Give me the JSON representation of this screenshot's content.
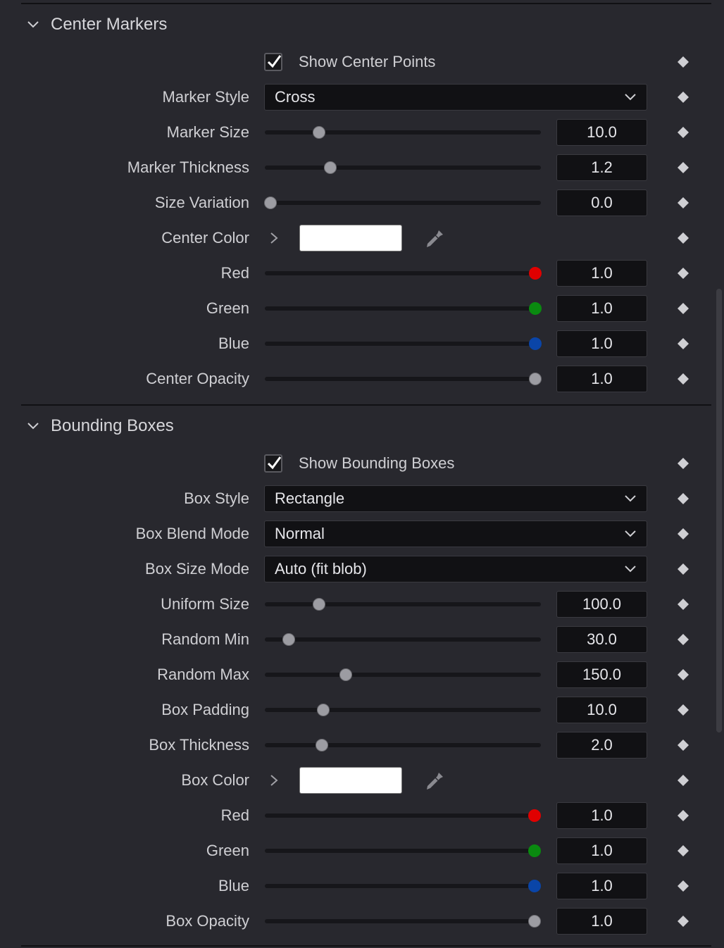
{
  "colors": {
    "red_knob": "#e00000",
    "green_knob": "#0a8a10",
    "blue_knob": "#0a45a8",
    "gray_knob": "#9c9ca2",
    "swatch": "#ffffff"
  },
  "center_markers": {
    "title": "Center Markers",
    "show_center_points": {
      "label": "Show Center Points",
      "checked": true
    },
    "marker_style": {
      "label": "Marker Style",
      "value": "Cross"
    },
    "marker_size": {
      "label": "Marker Size",
      "value": "10.0",
      "fraction": 0.196
    },
    "marker_thickness": {
      "label": "Marker Thickness",
      "value": "1.2",
      "fraction": 0.237
    },
    "size_variation": {
      "label": "Size Variation",
      "value": "0.0",
      "fraction": 0.02
    },
    "center_color": {
      "label": "Center Color",
      "swatch": "#ffffff"
    },
    "red": {
      "label": "Red",
      "value": "1.0",
      "fraction": 0.98
    },
    "green": {
      "label": "Green",
      "value": "1.0",
      "fraction": 0.98
    },
    "blue": {
      "label": "Blue",
      "value": "1.0",
      "fraction": 0.98
    },
    "center_opacity": {
      "label": "Center Opacity",
      "value": "1.0",
      "fraction": 0.98
    }
  },
  "bounding_boxes": {
    "title": "Bounding Boxes",
    "show_bounding_boxes": {
      "label": "Show Bounding Boxes",
      "checked": true
    },
    "box_style": {
      "label": "Box Style",
      "value": "Rectangle"
    },
    "box_blend_mode": {
      "label": "Box Blend Mode",
      "value": "Normal"
    },
    "box_size_mode": {
      "label": "Box Size Mode",
      "value": "Auto (fit blob)"
    },
    "uniform_size": {
      "label": "Uniform Size",
      "value": "100.0",
      "fraction": 0.196
    },
    "random_min": {
      "label": "Random Min",
      "value": "30.0",
      "fraction": 0.088
    },
    "random_max": {
      "label": "Random Max",
      "value": "150.0",
      "fraction": 0.293
    },
    "box_padding": {
      "label": "Box Padding",
      "value": "10.0",
      "fraction": 0.212
    },
    "box_thickness": {
      "label": "Box Thickness",
      "value": "2.0",
      "fraction": 0.207
    },
    "box_color": {
      "label": "Box Color",
      "swatch": "#ffffff"
    },
    "red": {
      "label": "Red",
      "value": "1.0",
      "fraction": 0.978
    },
    "green": {
      "label": "Green",
      "value": "1.0",
      "fraction": 0.978
    },
    "blue": {
      "label": "Blue",
      "value": "1.0",
      "fraction": 0.978
    },
    "box_opacity": {
      "label": "Box Opacity",
      "value": "1.0",
      "fraction": 0.978
    }
  }
}
